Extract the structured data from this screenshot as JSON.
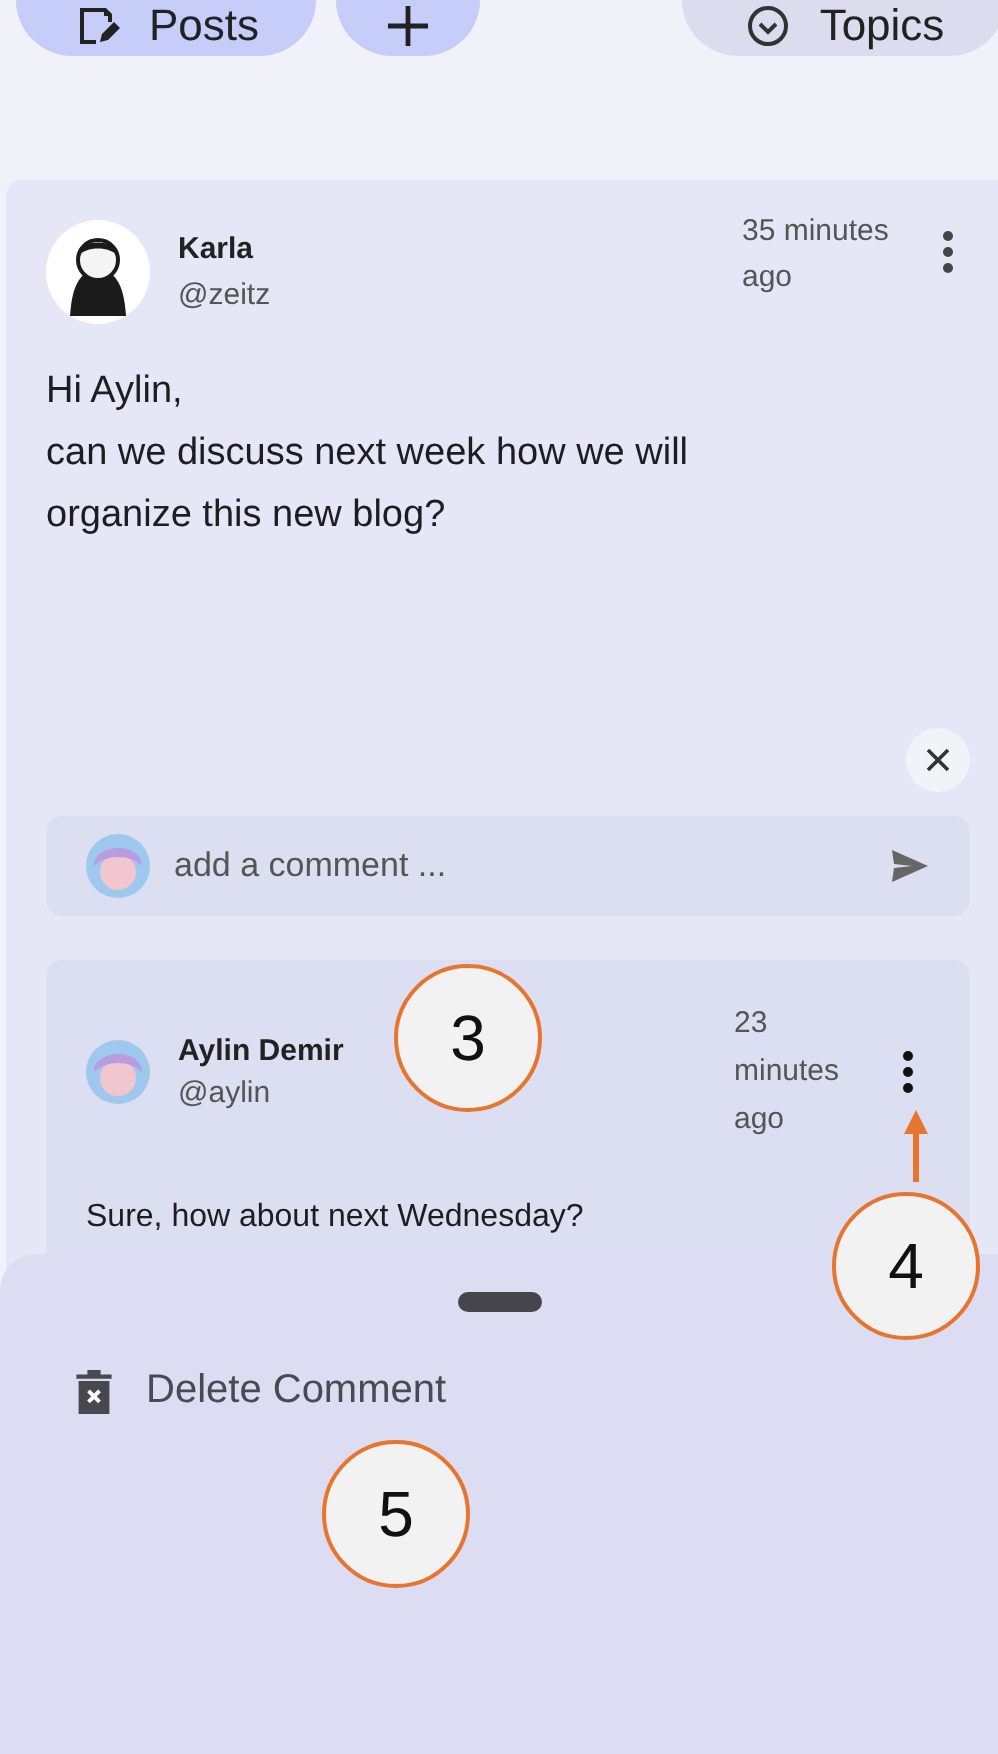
{
  "tabs": [
    {
      "kind": "posts",
      "label": "Posts",
      "selected": true
    },
    {
      "kind": "add",
      "selected": true
    },
    {
      "kind": "topics",
      "label": "Topics",
      "selected": false
    }
  ],
  "post": {
    "author": "Karla",
    "handle": "@zeitz",
    "time": "35 minutes ago",
    "lines": [
      "Hi Aylin,",
      "can we discuss next week how we will organize this new blog?"
    ]
  },
  "comment_field": {
    "placeholder": "add a comment ..."
  },
  "comments": [
    {
      "author": "Aylin Demir",
      "handle": "@aylin",
      "time": "23 minutes ago",
      "text": "Sure, how about next Wednesday?"
    }
  ],
  "sheet": {
    "actions": [
      {
        "label": "Delete Comment"
      }
    ]
  },
  "callouts": [
    "3",
    "4",
    "5"
  ]
}
